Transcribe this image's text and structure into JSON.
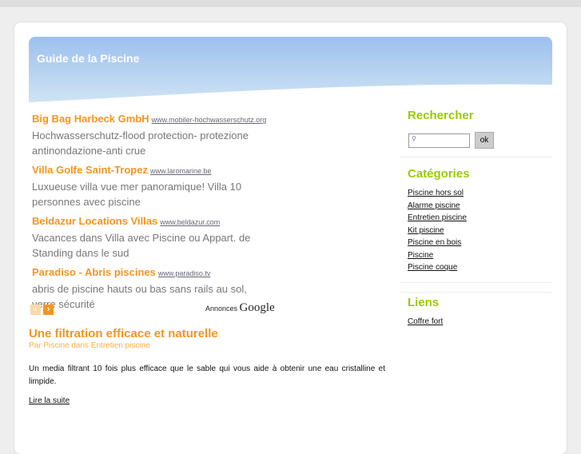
{
  "site": {
    "title": "Guide de la Piscine"
  },
  "ads": [
    {
      "title": "Big Bag Harbeck GmbH",
      "url": "www.mobiler-hochwasserschutz.org",
      "desc": "Hochwasserschutz-flood protection- protezione antinondazione-anti crue"
    },
    {
      "title": "Villa Golfe Saint-Tropez",
      "url": "www.laromarine.be",
      "desc": "Luxueuse villa vue mer panoramique! Villa 10 personnes avec piscine"
    },
    {
      "title": "Beldazur Locations Villas",
      "url": "www.beldazur.com",
      "desc": "Vacances dans Villa avec Piscine ou Appart. de Standing dans le sud"
    },
    {
      "title": "Paradiso - Abris piscines",
      "url": "www.paradiso.tv",
      "desc": "abris de piscine hauts ou bas sans rails au sol, verre sécurité"
    }
  ],
  "ads_by": {
    "label": "Annonces",
    "brand": "Google"
  },
  "post": {
    "title": "Une filtration efficace et naturelle",
    "meta": "Par Piscine dans Entretien piscine",
    "excerpt": "Un media filtrant 10 fois plus efficace que le sable qui vous aide à obtenir une eau cristalline et limpide.",
    "more": "Lire la suite"
  },
  "sidebar": {
    "search_title": "Rechercher",
    "search_value": "",
    "search_button": "ok",
    "categories_title": "Catégories",
    "categories": [
      "Piscine hors sol",
      "Alarme piscine",
      "Entretien piscine",
      "Kit piscine",
      "Piscine en bois",
      "Piscine",
      "Piscine coque"
    ],
    "links_title": "Liens",
    "links": [
      "Coffre fort"
    ]
  }
}
